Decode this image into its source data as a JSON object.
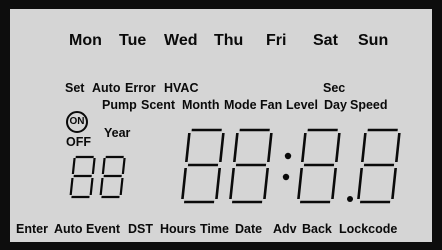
{
  "days": [
    "Mon",
    "Tue",
    "Wed",
    "Thu",
    "Fri",
    "Sat",
    "Sun"
  ],
  "top_labels": [
    "Set",
    "Auto",
    "Error",
    "HVAC",
    "Sec"
  ],
  "mid_labels": [
    "Pump",
    "Scent",
    "Month",
    "Mode",
    "Fan",
    "Level",
    "Day",
    "Speed"
  ],
  "left_labels": {
    "year": "Year",
    "on": "ON",
    "off": "OFF"
  },
  "small_display": "88",
  "main_display": {
    "hours": "88",
    "separator": ":",
    "minutes": "8.8"
  },
  "bottom_labels": [
    "Enter",
    "Auto",
    "Event",
    "DST",
    "Hours",
    "Time",
    "Date",
    "Adv",
    "Back",
    "Lockcode"
  ],
  "colors": {
    "bezel": "#0d0d0d",
    "lcd": "#d5d5d5",
    "segment": "#0a0a0a"
  }
}
